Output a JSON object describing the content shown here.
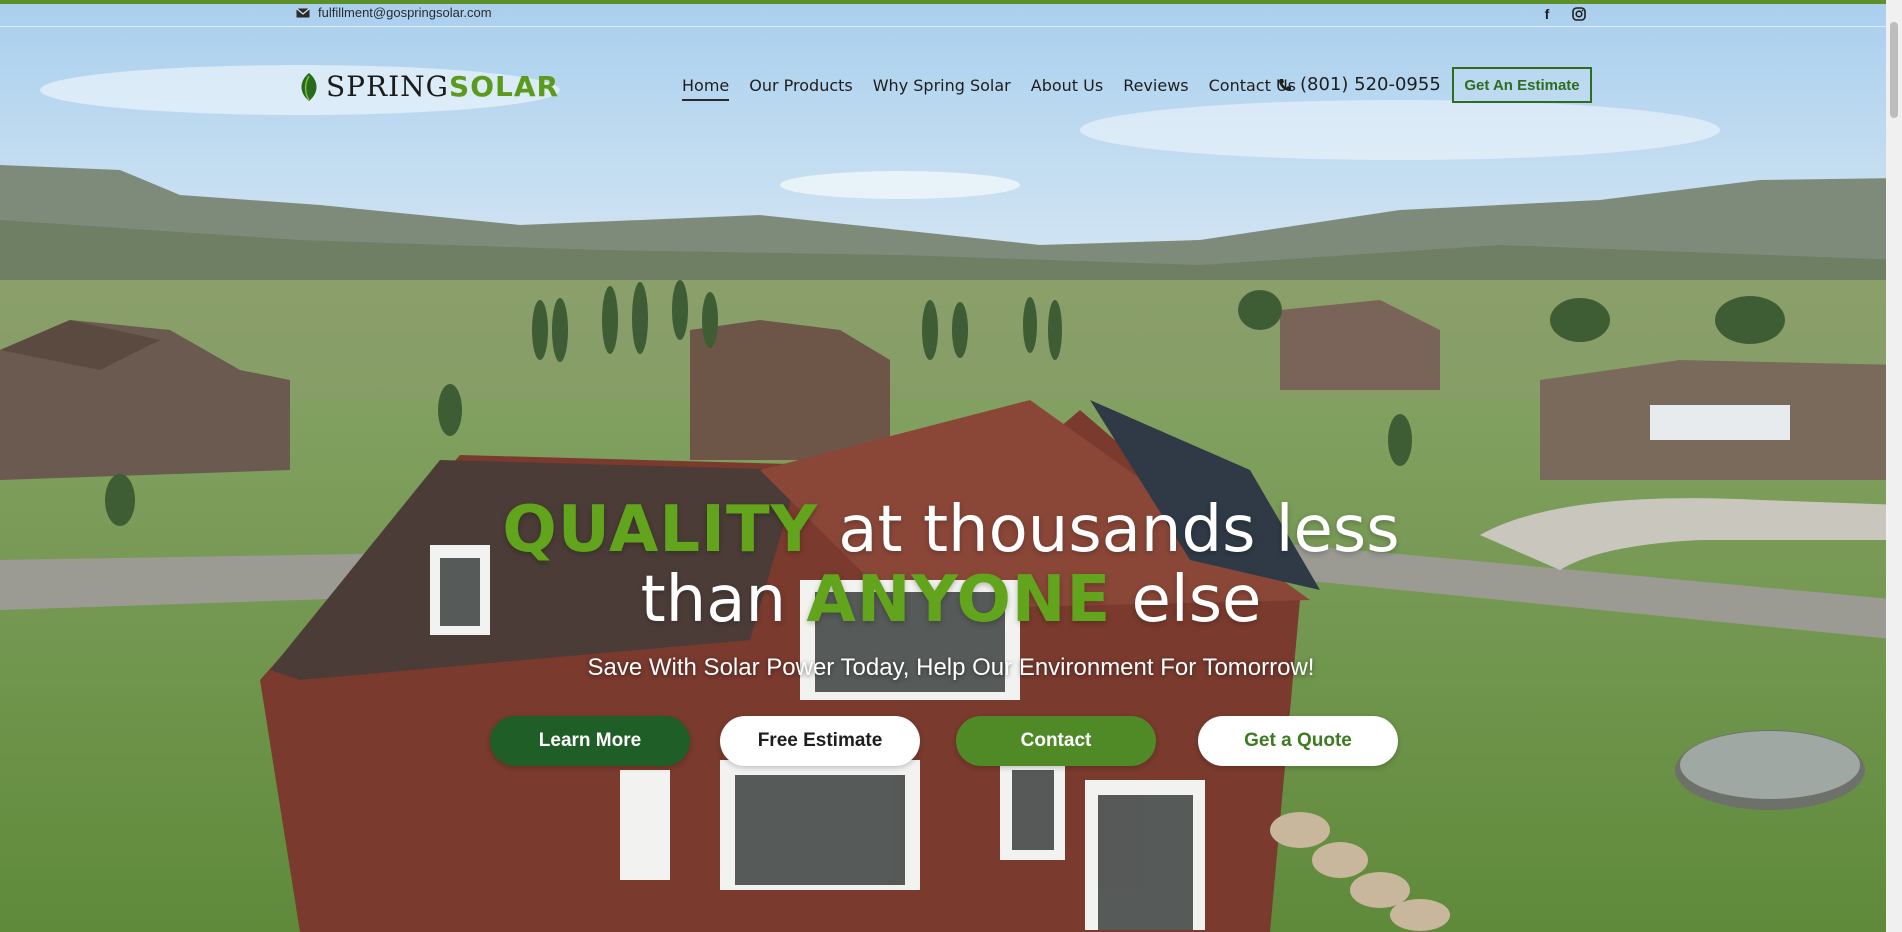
{
  "topbar": {
    "email": "fulfillment@gospringsolar.com",
    "social": [
      {
        "icon": "facebook-icon",
        "glyph": "f"
      },
      {
        "icon": "instagram-icon"
      }
    ]
  },
  "header": {
    "logo": {
      "word1": "SPRING",
      "word2": "SOLAR",
      "icon": "leaf-icon"
    },
    "nav": [
      {
        "label": "Home",
        "active": true
      },
      {
        "label": "Our Products"
      },
      {
        "label": "Why Spring Solar"
      },
      {
        "label": "About Us"
      },
      {
        "label": "Reviews"
      },
      {
        "label": "Contact Us"
      }
    ],
    "phone": {
      "icon": "phone-icon",
      "number": "(801) 520-0955"
    },
    "estimate_button": "Get An Estimate"
  },
  "hero": {
    "line1_accent": "QUALITY",
    "line1_rest": " at thousands less",
    "line2_pre": "than ",
    "line2_accent": "ANYONE",
    "line2_post": " else",
    "subtitle": "Save With Solar Power Today, Help Our Environment For Tomorrow!",
    "buttons": [
      {
        "label": "Learn More"
      },
      {
        "label": "Free Estimate"
      },
      {
        "label": "Contact"
      },
      {
        "label": "Get a Quote"
      }
    ]
  },
  "colors": {
    "brand_green": "#5a9a1c",
    "dark_green": "#1f5e26",
    "top_line": "#5a8f29"
  }
}
